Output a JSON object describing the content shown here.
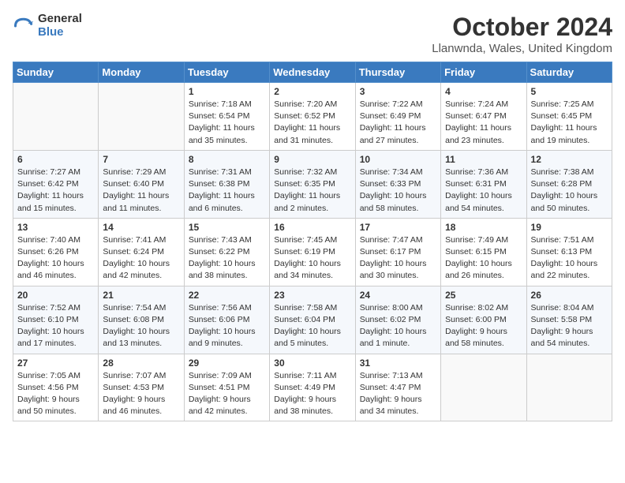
{
  "header": {
    "logo_general": "General",
    "logo_blue": "Blue",
    "month_title": "October 2024",
    "location": "Llanwnda, Wales, United Kingdom"
  },
  "days_of_week": [
    "Sunday",
    "Monday",
    "Tuesday",
    "Wednesday",
    "Thursday",
    "Friday",
    "Saturday"
  ],
  "weeks": [
    [
      {
        "day": "",
        "sunrise": "",
        "sunset": "",
        "daylight": ""
      },
      {
        "day": "",
        "sunrise": "",
        "sunset": "",
        "daylight": ""
      },
      {
        "day": "1",
        "sunrise": "Sunrise: 7:18 AM",
        "sunset": "Sunset: 6:54 PM",
        "daylight": "Daylight: 11 hours and 35 minutes."
      },
      {
        "day": "2",
        "sunrise": "Sunrise: 7:20 AM",
        "sunset": "Sunset: 6:52 PM",
        "daylight": "Daylight: 11 hours and 31 minutes."
      },
      {
        "day": "3",
        "sunrise": "Sunrise: 7:22 AM",
        "sunset": "Sunset: 6:49 PM",
        "daylight": "Daylight: 11 hours and 27 minutes."
      },
      {
        "day": "4",
        "sunrise": "Sunrise: 7:24 AM",
        "sunset": "Sunset: 6:47 PM",
        "daylight": "Daylight: 11 hours and 23 minutes."
      },
      {
        "day": "5",
        "sunrise": "Sunrise: 7:25 AM",
        "sunset": "Sunset: 6:45 PM",
        "daylight": "Daylight: 11 hours and 19 minutes."
      }
    ],
    [
      {
        "day": "6",
        "sunrise": "Sunrise: 7:27 AM",
        "sunset": "Sunset: 6:42 PM",
        "daylight": "Daylight: 11 hours and 15 minutes."
      },
      {
        "day": "7",
        "sunrise": "Sunrise: 7:29 AM",
        "sunset": "Sunset: 6:40 PM",
        "daylight": "Daylight: 11 hours and 11 minutes."
      },
      {
        "day": "8",
        "sunrise": "Sunrise: 7:31 AM",
        "sunset": "Sunset: 6:38 PM",
        "daylight": "Daylight: 11 hours and 6 minutes."
      },
      {
        "day": "9",
        "sunrise": "Sunrise: 7:32 AM",
        "sunset": "Sunset: 6:35 PM",
        "daylight": "Daylight: 11 hours and 2 minutes."
      },
      {
        "day": "10",
        "sunrise": "Sunrise: 7:34 AM",
        "sunset": "Sunset: 6:33 PM",
        "daylight": "Daylight: 10 hours and 58 minutes."
      },
      {
        "day": "11",
        "sunrise": "Sunrise: 7:36 AM",
        "sunset": "Sunset: 6:31 PM",
        "daylight": "Daylight: 10 hours and 54 minutes."
      },
      {
        "day": "12",
        "sunrise": "Sunrise: 7:38 AM",
        "sunset": "Sunset: 6:28 PM",
        "daylight": "Daylight: 10 hours and 50 minutes."
      }
    ],
    [
      {
        "day": "13",
        "sunrise": "Sunrise: 7:40 AM",
        "sunset": "Sunset: 6:26 PM",
        "daylight": "Daylight: 10 hours and 46 minutes."
      },
      {
        "day": "14",
        "sunrise": "Sunrise: 7:41 AM",
        "sunset": "Sunset: 6:24 PM",
        "daylight": "Daylight: 10 hours and 42 minutes."
      },
      {
        "day": "15",
        "sunrise": "Sunrise: 7:43 AM",
        "sunset": "Sunset: 6:22 PM",
        "daylight": "Daylight: 10 hours and 38 minutes."
      },
      {
        "day": "16",
        "sunrise": "Sunrise: 7:45 AM",
        "sunset": "Sunset: 6:19 PM",
        "daylight": "Daylight: 10 hours and 34 minutes."
      },
      {
        "day": "17",
        "sunrise": "Sunrise: 7:47 AM",
        "sunset": "Sunset: 6:17 PM",
        "daylight": "Daylight: 10 hours and 30 minutes."
      },
      {
        "day": "18",
        "sunrise": "Sunrise: 7:49 AM",
        "sunset": "Sunset: 6:15 PM",
        "daylight": "Daylight: 10 hours and 26 minutes."
      },
      {
        "day": "19",
        "sunrise": "Sunrise: 7:51 AM",
        "sunset": "Sunset: 6:13 PM",
        "daylight": "Daylight: 10 hours and 22 minutes."
      }
    ],
    [
      {
        "day": "20",
        "sunrise": "Sunrise: 7:52 AM",
        "sunset": "Sunset: 6:10 PM",
        "daylight": "Daylight: 10 hours and 17 minutes."
      },
      {
        "day": "21",
        "sunrise": "Sunrise: 7:54 AM",
        "sunset": "Sunset: 6:08 PM",
        "daylight": "Daylight: 10 hours and 13 minutes."
      },
      {
        "day": "22",
        "sunrise": "Sunrise: 7:56 AM",
        "sunset": "Sunset: 6:06 PM",
        "daylight": "Daylight: 10 hours and 9 minutes."
      },
      {
        "day": "23",
        "sunrise": "Sunrise: 7:58 AM",
        "sunset": "Sunset: 6:04 PM",
        "daylight": "Daylight: 10 hours and 5 minutes."
      },
      {
        "day": "24",
        "sunrise": "Sunrise: 8:00 AM",
        "sunset": "Sunset: 6:02 PM",
        "daylight": "Daylight: 10 hours and 1 minute."
      },
      {
        "day": "25",
        "sunrise": "Sunrise: 8:02 AM",
        "sunset": "Sunset: 6:00 PM",
        "daylight": "Daylight: 9 hours and 58 minutes."
      },
      {
        "day": "26",
        "sunrise": "Sunrise: 8:04 AM",
        "sunset": "Sunset: 5:58 PM",
        "daylight": "Daylight: 9 hours and 54 minutes."
      }
    ],
    [
      {
        "day": "27",
        "sunrise": "Sunrise: 7:05 AM",
        "sunset": "Sunset: 4:56 PM",
        "daylight": "Daylight: 9 hours and 50 minutes."
      },
      {
        "day": "28",
        "sunrise": "Sunrise: 7:07 AM",
        "sunset": "Sunset: 4:53 PM",
        "daylight": "Daylight: 9 hours and 46 minutes."
      },
      {
        "day": "29",
        "sunrise": "Sunrise: 7:09 AM",
        "sunset": "Sunset: 4:51 PM",
        "daylight": "Daylight: 9 hours and 42 minutes."
      },
      {
        "day": "30",
        "sunrise": "Sunrise: 7:11 AM",
        "sunset": "Sunset: 4:49 PM",
        "daylight": "Daylight: 9 hours and 38 minutes."
      },
      {
        "day": "31",
        "sunrise": "Sunrise: 7:13 AM",
        "sunset": "Sunset: 4:47 PM",
        "daylight": "Daylight: 9 hours and 34 minutes."
      },
      {
        "day": "",
        "sunrise": "",
        "sunset": "",
        "daylight": ""
      },
      {
        "day": "",
        "sunrise": "",
        "sunset": "",
        "daylight": ""
      }
    ]
  ]
}
